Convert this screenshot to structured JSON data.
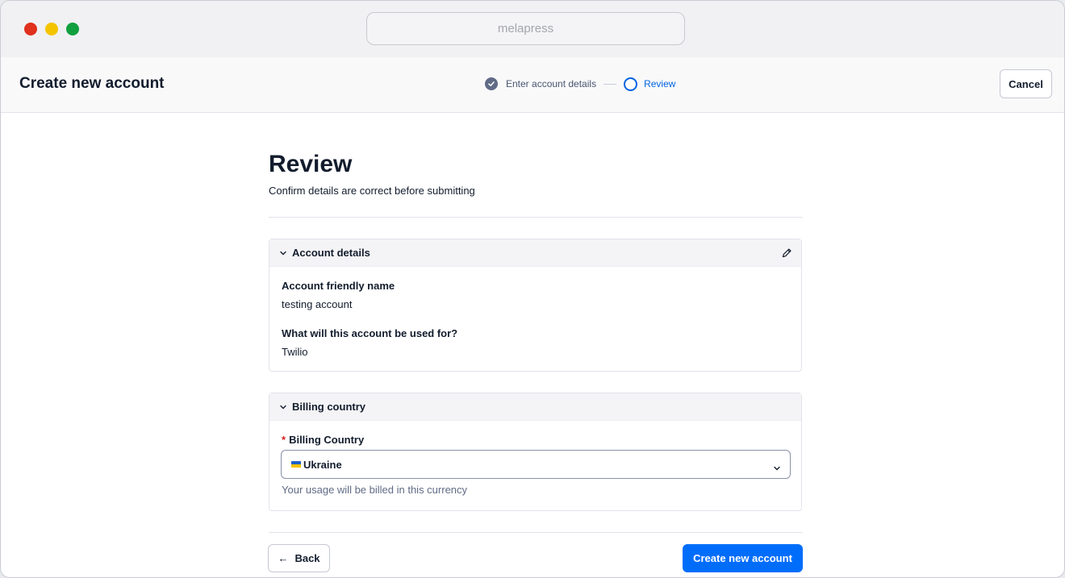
{
  "browser": {
    "url_text": "melapress"
  },
  "header": {
    "title": "Create new account",
    "stepper": {
      "step1_label": "Enter account details",
      "step2_label": "Review"
    },
    "cancel_label": "Cancel"
  },
  "review": {
    "title": "Review",
    "subtitle": "Confirm details are correct before submitting"
  },
  "account_details": {
    "heading": "Account details",
    "fields": [
      {
        "label": "Account friendly name",
        "value": "testing account"
      },
      {
        "label": "What will this account be used for?",
        "value": "Twilio"
      }
    ]
  },
  "billing": {
    "heading": "Billing country",
    "required_marker": "*",
    "field_label": "Billing Country",
    "selected_country": "Ukraine",
    "help_text": "Your usage will be billed in this currency"
  },
  "footer": {
    "back_label": "Back",
    "back_arrow": "←",
    "create_label": "Create new account"
  },
  "colors": {
    "primary": "#006dfa",
    "active_step": "#0263e0",
    "text": "#121c2d",
    "muted": "#606b85",
    "required": "#d61f1f"
  },
  "icons": {
    "check": "check-circle-icon",
    "current_step": "circle-icon",
    "chevron": "chevron-down-icon",
    "edit": "pencil-icon",
    "flag": "ukraine-flag-icon"
  }
}
